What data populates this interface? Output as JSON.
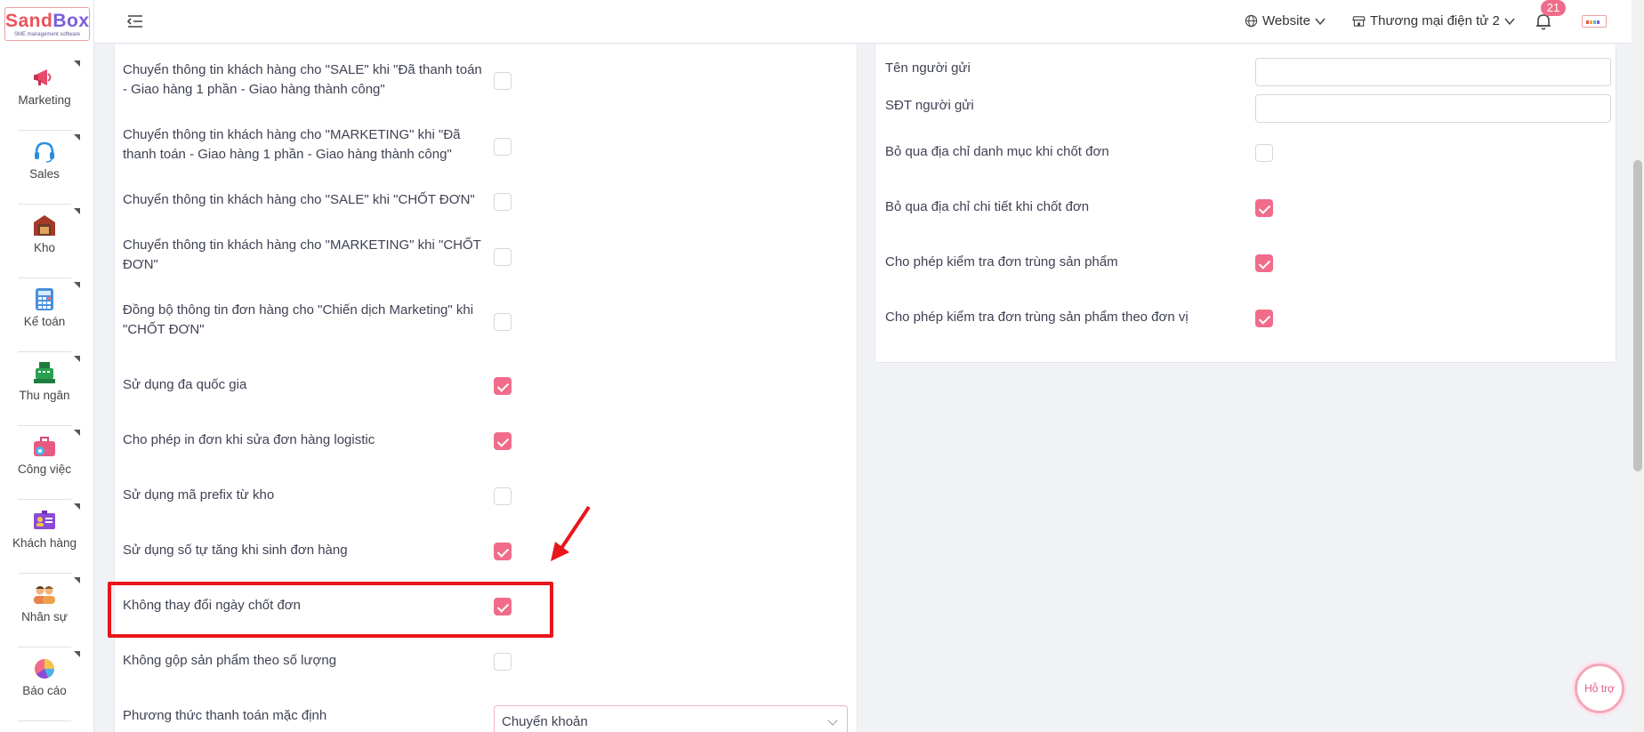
{
  "logo": {
    "part1": "Sand",
    "part2": "Box",
    "sub": "SME management software"
  },
  "sidebar": {
    "items": [
      {
        "label": "Marketing",
        "icon": "megaphone-icon"
      },
      {
        "label": "Sales",
        "icon": "headset-icon"
      },
      {
        "label": "Kho",
        "icon": "warehouse-icon"
      },
      {
        "label": "Kế toán",
        "icon": "calculator-icon"
      },
      {
        "label": "Thu ngân",
        "icon": "cash-register-icon"
      },
      {
        "label": "Công việc",
        "icon": "briefcase-icon"
      },
      {
        "label": "Khách hàng",
        "icon": "contact-card-icon"
      },
      {
        "label": "Nhân sự",
        "icon": "people-icon"
      },
      {
        "label": "Báo cáo",
        "icon": "pie-chart-icon"
      }
    ]
  },
  "header": {
    "website_label": "Website",
    "store_label": "Thương mại điện tử 2",
    "notification_count": "21"
  },
  "left_settings": [
    {
      "label": "Chuyển thông tin khách hàng cho \"SALE\" khi \"Đã thanh toán - Giao hàng 1 phần - Giao hàng thành công\"",
      "checked": false
    },
    {
      "label": "Chuyển thông tin khách hàng cho \"MARKETING\" khi \"Đã thanh toán - Giao hàng 1 phần - Giao hàng thành công\"",
      "checked": false
    },
    {
      "label": "Chuyển thông tin khách hàng cho \"SALE\" khi \"CHỐT ĐƠN\"",
      "checked": false
    },
    {
      "label": "Chuyển thông tin khách hàng cho \"MARKETING\" khi \"CHỐT ĐƠN\"",
      "checked": false
    },
    {
      "label": "Đồng bộ thông tin đơn hàng cho \"Chiến dịch Marketing\" khi \"CHỐT ĐƠN\"",
      "checked": false
    },
    {
      "label": "Sử dụng đa quốc gia",
      "checked": true
    },
    {
      "label": "Cho phép in đơn khi sửa đơn hàng logistic",
      "checked": true
    },
    {
      "label": "Sử dụng mã prefix từ kho",
      "checked": false
    },
    {
      "label": "Sử dụng số tự tăng khi sinh đơn hàng",
      "checked": true
    },
    {
      "label": "Không thay đổi ngày chốt đơn",
      "checked": true
    },
    {
      "label": "Không gộp sản phẩm theo số lượng",
      "checked": false
    }
  ],
  "payment": {
    "label": "Phương thức thanh toán mặc định",
    "value": "Chuyển khoản"
  },
  "right_settings": {
    "sender_name_label": "Tên người gửi",
    "sender_phone_label": "SĐT người gửi",
    "checks": [
      {
        "label": "Bỏ qua địa chỉ danh mục khi chốt đơn",
        "checked": false
      },
      {
        "label": "Bỏ qua địa chỉ chi tiết khi chốt đơn",
        "checked": true
      },
      {
        "label": "Cho phép kiểm tra đơn trùng sản phẩm",
        "checked": true
      },
      {
        "label": "Cho phép kiểm tra đơn trùng sản phẩm theo đơn vị",
        "checked": true
      }
    ]
  },
  "support_label": "Hỗ trợ",
  "colors": {
    "accent": "#f06c8a",
    "highlight": "#e8151b"
  }
}
